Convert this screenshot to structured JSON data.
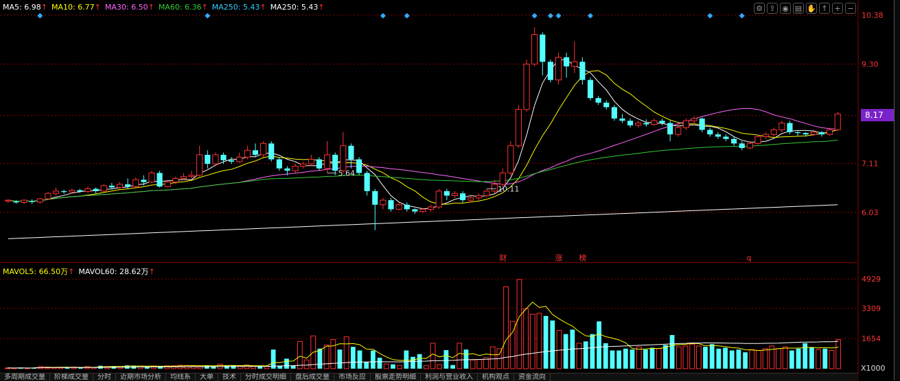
{
  "legend_price": [
    {
      "key": "ma5",
      "label": "MA5: 6.98",
      "color": "#ffffff"
    },
    {
      "key": "ma10",
      "label": "MA10: 6.77",
      "color": "#ffff00"
    },
    {
      "key": "ma30",
      "label": "MA30: 6.50",
      "color": "#ff66ff"
    },
    {
      "key": "ma60",
      "label": "MA60: 6.36",
      "color": "#33cc33"
    },
    {
      "key": "ma250",
      "label": "MA250: 5.43",
      "color": "#33ccff"
    },
    {
      "key": "ma250b",
      "label": "MA250: 5.43",
      "color": "#ffffff"
    }
  ],
  "legend_volume": [
    {
      "key": "mavol5",
      "label": "MAVOL5: 66.50万",
      "color": "#ffff00"
    },
    {
      "key": "mavol60",
      "label": "MAVOL60: 28.62万",
      "color": "#ffffff"
    }
  ],
  "up_arrow": "↑",
  "price_badge": "8.17",
  "toolbar_icons": [
    "settings-icon",
    "share-icon",
    "eye-icon",
    "print-icon",
    "hand-icon",
    "arrow-up-icon",
    "zoom-in-icon",
    "zoom-out-icon"
  ],
  "markers": [
    "财",
    "涨",
    "榜",
    "q"
  ],
  "tabs": [
    "多周期成交量",
    "阶梯成交量",
    "分时",
    "近期市场分析",
    "均线系",
    "大单",
    "技术",
    "分时成交明细",
    "盘后成交量",
    "市场反应",
    "股票走势明细",
    "利润与营业收入",
    "机构观点",
    "资金流向"
  ],
  "colors": {
    "up": "#ff3232",
    "down": "#54ffff",
    "grid": "#8b0000",
    "axis_text": "#ff3232",
    "vol_ma5": "#ffff00",
    "vol_ma60": "#ffffff"
  },
  "chart_data": [
    {
      "type": "candlestick",
      "y_ticks": [
        "10.38",
        "9.30",
        "8.17",
        "7.11",
        "6.03"
      ],
      "ylim": [
        5.2,
        10.5
      ],
      "annotations": [
        {
          "label": "10.11",
          "at_index": 60
        },
        {
          "label": "5.64",
          "at_index": 40
        }
      ],
      "candles": [
        [
          6.28,
          6.3,
          6.24,
          6.32
        ],
        [
          6.27,
          6.25,
          6.22,
          6.3
        ],
        [
          6.25,
          6.3,
          6.22,
          6.32
        ],
        [
          6.28,
          6.26,
          6.22,
          6.32
        ],
        [
          6.26,
          6.33,
          6.22,
          6.35
        ],
        [
          6.33,
          6.45,
          6.3,
          6.48
        ],
        [
          6.45,
          6.5,
          6.4,
          6.58
        ],
        [
          6.5,
          6.48,
          6.44,
          6.53
        ],
        [
          6.48,
          6.52,
          6.45,
          6.55
        ],
        [
          6.52,
          6.49,
          6.46,
          6.55
        ],
        [
          6.49,
          6.55,
          6.46,
          6.6
        ],
        [
          6.55,
          6.5,
          6.45,
          6.58
        ],
        [
          6.5,
          6.62,
          6.48,
          6.65
        ],
        [
          6.62,
          6.58,
          6.54,
          6.68
        ],
        [
          6.58,
          6.65,
          6.55,
          6.7
        ],
        [
          6.65,
          6.6,
          6.55,
          6.78
        ],
        [
          6.6,
          6.75,
          6.58,
          6.8
        ],
        [
          6.75,
          6.7,
          6.62,
          6.85
        ],
        [
          6.7,
          6.9,
          6.68,
          6.95
        ],
        [
          6.9,
          6.6,
          6.58,
          6.95
        ],
        [
          6.6,
          6.7,
          6.58,
          6.75
        ],
        [
          6.7,
          6.78,
          6.65,
          6.82
        ],
        [
          6.78,
          6.82,
          6.74,
          6.9
        ],
        [
          6.82,
          6.85,
          6.78,
          6.95
        ],
        [
          6.85,
          7.3,
          6.82,
          7.5
        ],
        [
          7.3,
          7.1,
          7.0,
          7.4
        ],
        [
          7.1,
          7.3,
          7.05,
          7.35
        ],
        [
          7.3,
          7.18,
          7.1,
          7.35
        ],
        [
          7.18,
          7.15,
          7.1,
          7.25
        ],
        [
          7.15,
          7.25,
          7.12,
          7.35
        ],
        [
          7.25,
          7.4,
          7.2,
          7.5
        ],
        [
          7.4,
          7.3,
          7.25,
          7.55
        ],
        [
          7.3,
          7.55,
          7.25,
          7.6
        ],
        [
          7.55,
          7.2,
          7.15,
          7.6
        ],
        [
          7.2,
          7.0,
          6.95,
          7.25
        ],
        [
          7.0,
          6.95,
          6.85,
          7.05
        ],
        [
          6.95,
          7.05,
          6.9,
          7.1
        ],
        [
          7.05,
          7.1,
          7.0,
          7.15
        ],
        [
          7.1,
          7.2,
          7.05,
          7.3
        ],
        [
          7.2,
          7.0,
          6.95,
          7.25
        ],
        [
          7.0,
          7.3,
          6.9,
          7.6
        ],
        [
          7.3,
          6.95,
          6.85,
          7.35
        ],
        [
          6.95,
          7.5,
          6.9,
          7.8
        ],
        [
          7.5,
          7.2,
          7.0,
          7.55
        ],
        [
          7.2,
          6.9,
          6.85,
          7.25
        ],
        [
          6.9,
          6.5,
          6.4,
          6.95
        ],
        [
          6.5,
          6.2,
          5.64,
          6.55
        ],
        [
          6.2,
          6.3,
          6.1,
          6.35
        ],
        [
          6.3,
          6.1,
          6.05,
          6.35
        ],
        [
          6.1,
          6.2,
          6.08,
          6.25
        ],
        [
          6.2,
          6.1,
          6.05,
          6.25
        ],
        [
          6.1,
          6.05,
          6.0,
          6.12
        ],
        [
          6.05,
          6.1,
          6.02,
          6.12
        ],
        [
          6.1,
          6.15,
          6.05,
          6.2
        ],
        [
          6.15,
          6.5,
          6.1,
          6.55
        ],
        [
          6.5,
          6.4,
          6.3,
          6.55
        ],
        [
          6.4,
          6.45,
          6.35,
          6.5
        ],
        [
          6.45,
          6.3,
          6.25,
          6.5
        ],
        [
          6.3,
          6.35,
          6.25,
          6.4
        ],
        [
          6.35,
          6.4,
          6.3,
          6.45
        ],
        [
          6.4,
          6.5,
          6.38,
          6.55
        ],
        [
          6.5,
          6.65,
          6.45,
          6.75
        ],
        [
          6.65,
          6.9,
          6.6,
          7.0
        ],
        [
          6.9,
          7.5,
          6.85,
          7.6
        ],
        [
          7.5,
          8.3,
          7.45,
          8.4
        ],
        [
          8.3,
          9.3,
          8.25,
          9.4
        ],
        [
          9.3,
          9.95,
          9.25,
          10.11
        ],
        [
          9.95,
          9.35,
          9.05,
          10.0
        ],
        [
          9.35,
          8.95,
          8.9,
          9.4
        ],
        [
          8.95,
          9.45,
          8.85,
          9.55
        ],
        [
          9.45,
          9.25,
          9.0,
          9.55
        ],
        [
          9.25,
          9.35,
          9.1,
          9.8
        ],
        [
          9.35,
          8.95,
          8.85,
          9.45
        ],
        [
          8.95,
          8.55,
          8.5,
          9.0
        ],
        [
          8.55,
          8.45,
          8.4,
          8.6
        ],
        [
          8.45,
          8.35,
          8.3,
          8.5
        ],
        [
          8.35,
          8.1,
          8.05,
          8.4
        ],
        [
          8.1,
          8.05,
          8.0,
          8.2
        ],
        [
          8.05,
          7.95,
          7.9,
          8.1
        ],
        [
          7.95,
          8.0,
          7.9,
          8.05
        ],
        [
          8.0,
          7.97,
          7.92,
          8.08
        ],
        [
          7.97,
          8.05,
          7.95,
          8.1
        ],
        [
          8.05,
          8.0,
          7.95,
          8.1
        ],
        [
          8.0,
          7.75,
          7.6,
          8.05
        ],
        [
          7.75,
          7.9,
          7.7,
          8.0
        ],
        [
          7.9,
          8.05,
          7.85,
          8.1
        ],
        [
          8.05,
          8.1,
          7.95,
          8.15
        ],
        [
          8.1,
          7.85,
          7.8,
          8.12
        ],
        [
          7.85,
          7.75,
          7.7,
          7.9
        ],
        [
          7.75,
          7.7,
          7.65,
          7.8
        ],
        [
          7.7,
          7.65,
          7.6,
          7.75
        ],
        [
          7.65,
          7.55,
          7.5,
          7.7
        ],
        [
          7.55,
          7.45,
          7.4,
          7.6
        ],
        [
          7.45,
          7.55,
          7.42,
          7.6
        ],
        [
          7.55,
          7.7,
          7.52,
          7.75
        ],
        [
          7.7,
          7.75,
          7.65,
          7.8
        ],
        [
          7.75,
          7.85,
          7.7,
          7.9
        ],
        [
          7.85,
          8.0,
          7.8,
          8.05
        ],
        [
          8.0,
          7.8,
          7.75,
          8.05
        ],
        [
          7.8,
          7.78,
          7.72,
          7.82
        ],
        [
          7.78,
          7.75,
          7.7,
          7.8
        ],
        [
          7.75,
          7.8,
          7.72,
          7.85
        ],
        [
          7.8,
          7.75,
          7.7,
          7.82
        ],
        [
          7.75,
          7.85,
          7.72,
          7.9
        ],
        [
          7.85,
          8.2,
          7.82,
          8.25
        ]
      ]
    },
    {
      "type": "bar",
      "y_ticks": [
        "4929",
        "3309",
        "1654"
      ],
      "x_unit": "X1000",
      "ylim": [
        0,
        5200
      ],
      "volumes": [
        40,
        35,
        50,
        30,
        60,
        120,
        90,
        60,
        70,
        50,
        90,
        60,
        110,
        70,
        160,
        120,
        140,
        100,
        180,
        170,
        150,
        120,
        110,
        130,
        160,
        160,
        190,
        180,
        150,
        130,
        180,
        140,
        250,
        160,
        170,
        130,
        200,
        140,
        160,
        150,
        1050,
        170,
        550,
        180,
        1500,
        480,
        1800,
        1100,
        1300,
        1600,
        1050,
        1750,
        1200,
        1000,
        380,
        1000,
        600,
        260,
        240,
        180,
        1000,
        650,
        800,
        180,
        1400,
        220,
        1020,
        200,
        1400,
        1050,
        480,
        500,
        600,
        1200,
        1100,
        4500,
        2600,
        4900,
        3300,
        3000,
        3050,
        2900,
        2650,
        2100,
        1900,
        2150,
        1400,
        1500,
        1900,
        2600,
        1400,
        1000,
        1000,
        1100,
        1050,
        1200,
        1050,
        1150,
        1100,
        1300,
        1850,
        1200,
        1250,
        1350,
        1250,
        1200,
        1350,
        1100,
        1150,
        1000,
        1050,
        900,
        1050,
        1000,
        1100,
        1250,
        1100,
        1200,
        1000,
        1100,
        1400,
        1150,
        1050,
        1100,
        1000,
        1600
      ]
    }
  ]
}
